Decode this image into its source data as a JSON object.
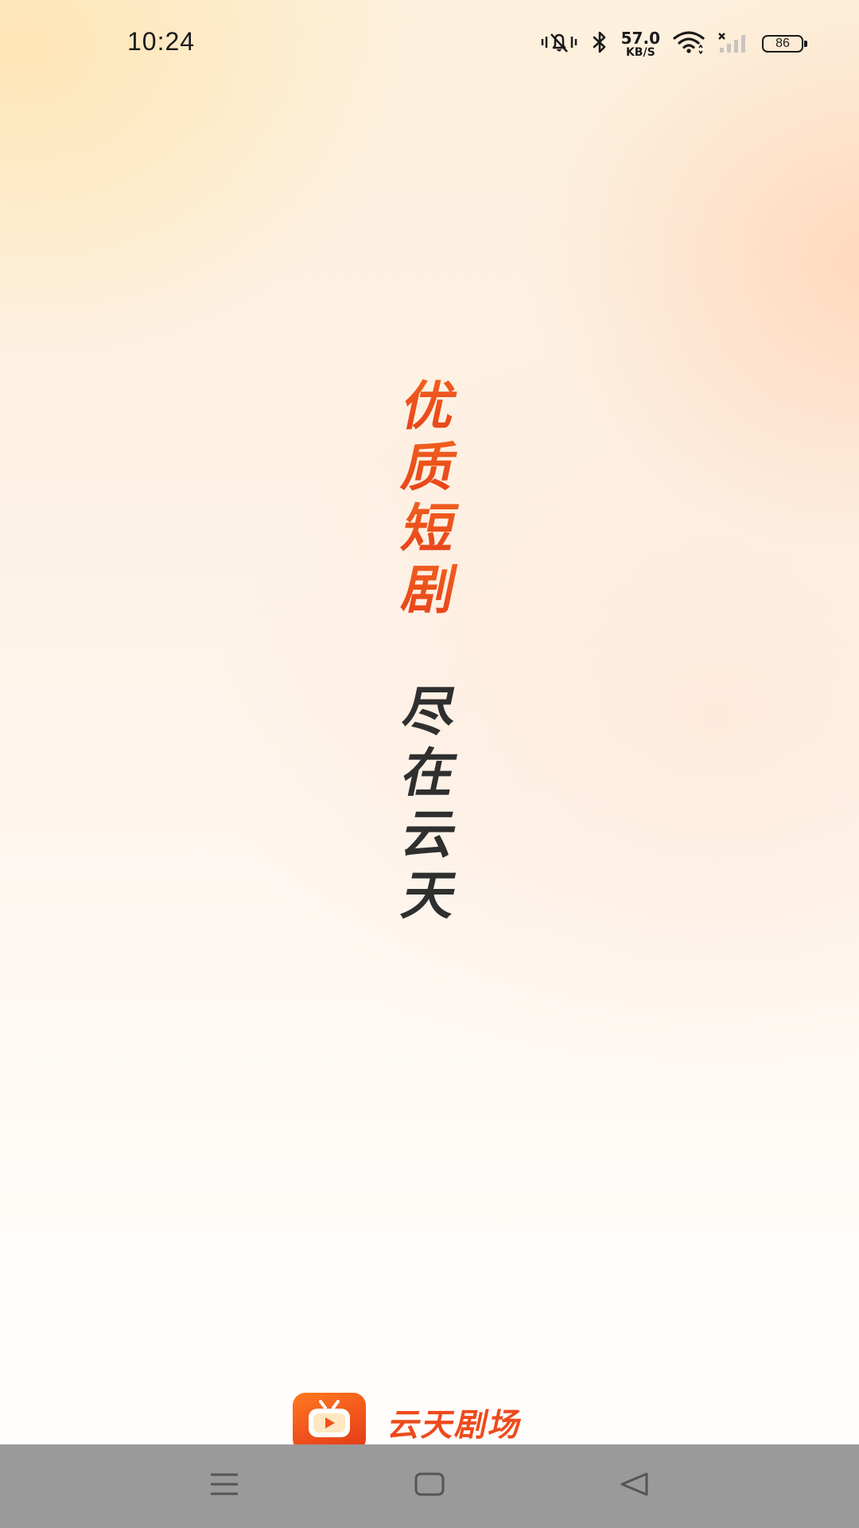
{
  "status_bar": {
    "time": "10:24",
    "net_speed_value": "57.0",
    "net_speed_unit": "KB/S",
    "battery_level": "86",
    "icons": [
      "mute-vibrate-icon",
      "bluetooth-icon",
      "wifi-icon",
      "cellular-no-signal-icon",
      "battery-icon"
    ]
  },
  "slogan": {
    "line1": [
      "优",
      "质",
      "短",
      "剧"
    ],
    "line2": [
      "尽",
      "在",
      "云",
      "天"
    ]
  },
  "brand": {
    "name": "云天剧场",
    "logo_icon": "tv-play-icon"
  },
  "nav_bar": {
    "buttons": [
      "menu-icon",
      "home-icon",
      "back-icon"
    ]
  },
  "colors": {
    "accent": "#f04e1c",
    "slogan_dark": "#2f2f2f",
    "nav_bar": "#9a9a9a"
  }
}
